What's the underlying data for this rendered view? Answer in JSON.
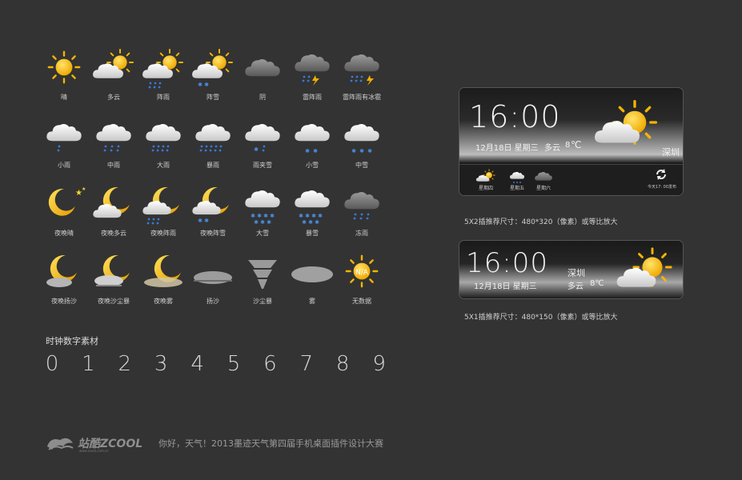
{
  "icons": [
    {
      "name": "sunny-icon",
      "label": "晴"
    },
    {
      "name": "partly-cloudy-icon",
      "label": "多云"
    },
    {
      "name": "shower-icon",
      "label": "阵雨"
    },
    {
      "name": "snow-shower-icon",
      "label": "阵雪"
    },
    {
      "name": "overcast-icon",
      "label": "阴"
    },
    {
      "name": "thunderstorm-icon",
      "label": "雷阵雨"
    },
    {
      "name": "thunder-hail-icon",
      "label": "雷阵雨有冰雹"
    },
    {
      "name": "light-rain-icon",
      "label": "小雨"
    },
    {
      "name": "moderate-rain-icon",
      "label": "中雨"
    },
    {
      "name": "heavy-rain-icon",
      "label": "大雨"
    },
    {
      "name": "storm-rain-icon",
      "label": "暴雨"
    },
    {
      "name": "sleet-icon",
      "label": "雨夹雪"
    },
    {
      "name": "light-snow-icon",
      "label": "小雪"
    },
    {
      "name": "moderate-snow-icon",
      "label": "中雪"
    },
    {
      "name": "night-clear-icon",
      "label": "夜晚晴"
    },
    {
      "name": "night-cloudy-icon",
      "label": "夜晚多云"
    },
    {
      "name": "night-shower-icon",
      "label": "夜晚阵雨"
    },
    {
      "name": "night-snow-shower-icon",
      "label": "夜晚阵雪"
    },
    {
      "name": "heavy-snow-icon",
      "label": "大雪"
    },
    {
      "name": "snowstorm-icon",
      "label": "暴雪"
    },
    {
      "name": "freezing-rain-icon",
      "label": "冻雨"
    },
    {
      "name": "night-dust-icon",
      "label": "夜晚扬沙"
    },
    {
      "name": "night-sandstorm-icon",
      "label": "夜晚沙尘暴"
    },
    {
      "name": "night-fog-icon",
      "label": "夜晚雾"
    },
    {
      "name": "blowing-sand-icon",
      "label": "扬沙"
    },
    {
      "name": "sandstorm-icon",
      "label": "沙尘暴"
    },
    {
      "name": "fog-icon",
      "label": "雾"
    },
    {
      "name": "no-data-icon",
      "label": "无数据"
    }
  ],
  "na_text": "N/A",
  "digits_title": "时钟数字素材",
  "digits": [
    "0",
    "1",
    "2",
    "3",
    "4",
    "5",
    "6",
    "7",
    "8",
    "9"
  ],
  "widget1": {
    "time": "16:00",
    "date": "12月18日  星期三",
    "weather": "多云",
    "temp": "8",
    "city": "深圳",
    "days": [
      "星期四",
      "星期五",
      "星期六"
    ],
    "refresh_text": "今天17: 00发布",
    "note": "5X2插推荐尺寸：480*320（像素）或等比放大"
  },
  "widget2": {
    "time": "16:00",
    "date": "12月18日  星期三",
    "city": "深圳",
    "weather": "多云",
    "temp": "8℃",
    "note": "5X1插推荐尺寸：480*150（像素）或等比放大"
  },
  "footer": {
    "logo": "站酷ZCOOL",
    "logo_sub": "www.zcool.com.cn",
    "text": "你好，天气！2013墨迹天气第四届手机桌面插件设计大赛"
  },
  "colors": {
    "background": "#333333",
    "sun": "#f5b800",
    "cloud": "#f2f2f2",
    "rain": "#3a78d6",
    "bolt": "#f0b000"
  }
}
